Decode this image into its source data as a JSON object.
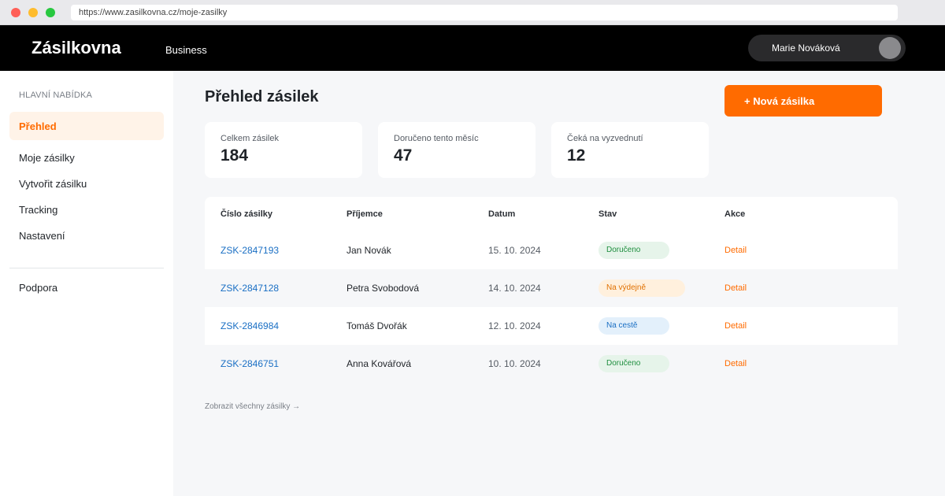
{
  "browser": {
    "url": "https://www.zasilkovna.cz/moje-zasilky"
  },
  "header": {
    "logo": "Zásilkovna",
    "section": "Business",
    "user_name": "Marie Nováková"
  },
  "sidebar": {
    "heading": "HLAVNÍ NABÍDKA",
    "items": [
      {
        "label": "Přehled"
      },
      {
        "label": "Moje zásilky"
      },
      {
        "label": "Vytvořit zásilku"
      },
      {
        "label": "Tracking"
      },
      {
        "label": "Nastavení"
      }
    ],
    "support": "Podpora"
  },
  "main": {
    "title": "Přehled zásilek",
    "new_button": "+ Nová zásilka",
    "stats": [
      {
        "label": "Celkem zásilek",
        "value": "184"
      },
      {
        "label": "Doručeno tento měsíc",
        "value": "47"
      },
      {
        "label": "Čeká na vyzvednutí",
        "value": "12"
      }
    ],
    "table": {
      "headers": [
        "Číslo zásilky",
        "Příjemce",
        "Datum",
        "Stav",
        "Akce"
      ],
      "rows": [
        {
          "id": "ZSK-2847193",
          "recipient": "Jan Novák",
          "date": "15. 10. 2024",
          "status": "Doručeno",
          "action": "Detail"
        },
        {
          "id": "ZSK-2847128",
          "recipient": "Petra Svobodová",
          "date": "14. 10. 2024",
          "status": "Na výdejně",
          "action": "Detail"
        },
        {
          "id": "ZSK-2846984",
          "recipient": "Tomáš Dvořák",
          "date": "12. 10. 2024",
          "status": "Na cestě",
          "action": "Detail"
        },
        {
          "id": "ZSK-2846751",
          "recipient": "Anna Kovářová",
          "date": "10. 10. 2024",
          "status": "Doručeno",
          "action": "Detail"
        }
      ]
    },
    "show_all": "Zobrazit všechny zásilky →"
  },
  "colors": {
    "accent": "#ff6b00",
    "link": "#1a6fc4",
    "status_delivered": "#1e8e3e",
    "status_pickup": "#e07000",
    "status_transit": "#1a6fc4"
  }
}
